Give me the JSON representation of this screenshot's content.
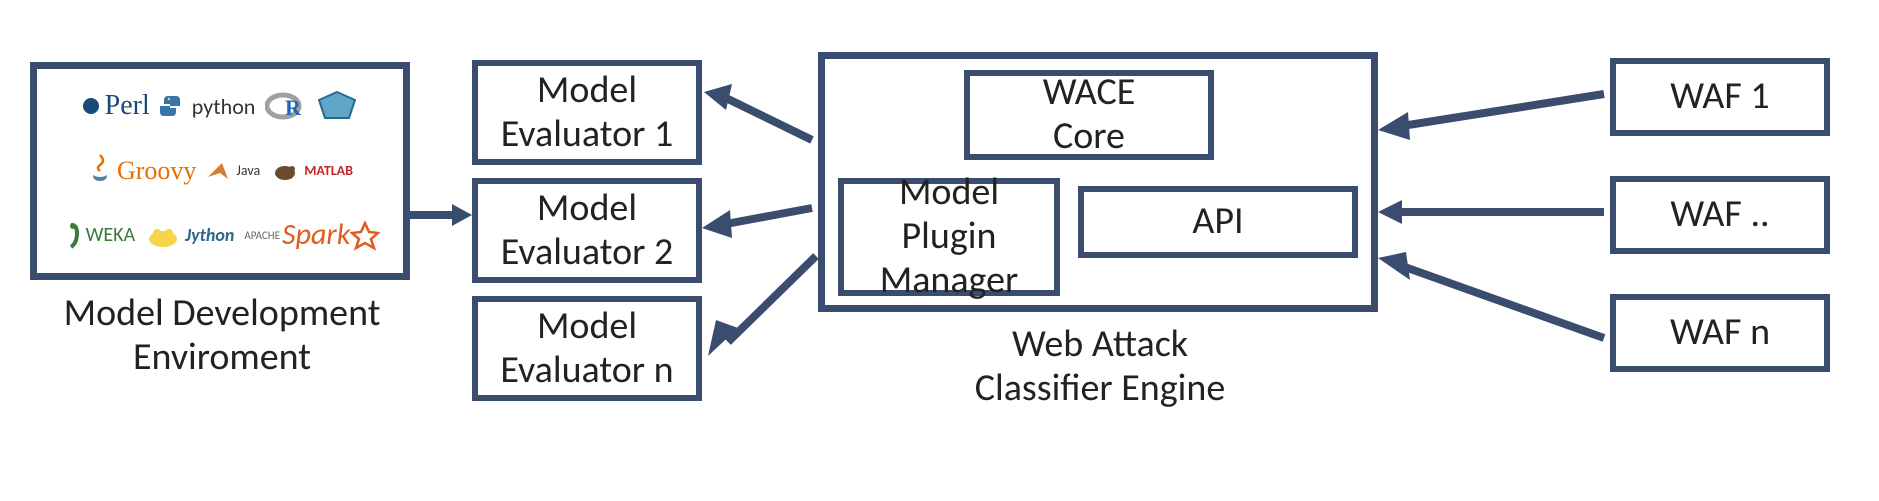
{
  "mde": {
    "label": "Model Development\nEnviroment",
    "techs": [
      "Perl",
      "python",
      "R",
      "Groovy",
      "Java",
      "MATLAB",
      "WEKA",
      "Jython",
      "hadoop",
      "Apache Spark"
    ]
  },
  "evaluators": {
    "e1": "Model\nEvaluator 1",
    "e2": "Model\nEvaluator 2",
    "en": "Model\nEvaluator n"
  },
  "wace": {
    "label": "Web Attack\nClassifier Engine",
    "core": "WACE\nCore",
    "plugin": "Model\nPlugin\nManager",
    "api": "API"
  },
  "wafs": {
    "w1": "WAF 1",
    "w2": "WAF ..",
    "wn": "WAF n"
  }
}
